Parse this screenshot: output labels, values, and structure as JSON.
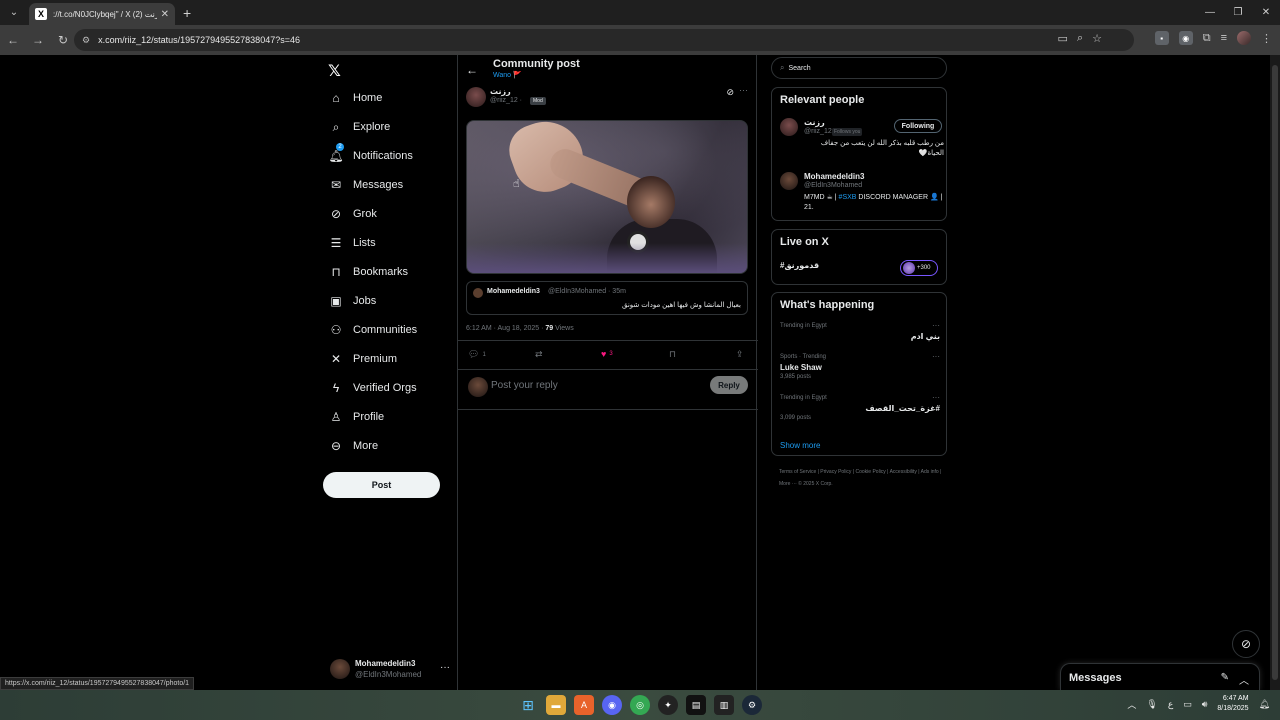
{
  "browser": {
    "tab_title": "://t.co/N0JClybqej\" / X رزنت (2)",
    "url": "x.com/riiz_12/status/1957279495527838047?s=46",
    "status_url": "https://x.com/riiz_12/status/1957279495527838047/photo/1"
  },
  "nav": {
    "items": [
      {
        "label": "Home",
        "icon": "home-icon"
      },
      {
        "label": "Explore",
        "icon": "search-icon"
      },
      {
        "label": "Notifications",
        "icon": "bell-icon",
        "badge": "2"
      },
      {
        "label": "Messages",
        "icon": "mail-icon"
      },
      {
        "label": "Grok",
        "icon": "grok-icon"
      },
      {
        "label": "Lists",
        "icon": "list-icon"
      },
      {
        "label": "Bookmarks",
        "icon": "bookmark-icon"
      },
      {
        "label": "Jobs",
        "icon": "briefcase-icon"
      },
      {
        "label": "Communities",
        "icon": "people-icon"
      },
      {
        "label": "Premium",
        "icon": "x-icon"
      },
      {
        "label": "Verified Orgs",
        "icon": "bolt-icon"
      },
      {
        "label": "Profile",
        "icon": "person-icon"
      },
      {
        "label": "More",
        "icon": "more-circle-icon"
      }
    ],
    "post_label": "Post",
    "account": {
      "name": "Mohamedeldin3",
      "handle": "@EldIn3Mohamed"
    }
  },
  "post": {
    "header_title": "Community post",
    "community": "Wano 🚩",
    "author_name": "رزنت",
    "author_handle": "@riiz_12 ·",
    "author_badge": "Mod",
    "quote": {
      "name": "Mohamedeldin3",
      "handle": "@EldIn3Mohamed · 35m",
      "text": "بعيال المانشا وش فيها اهين مودات شونق"
    },
    "time": "6:12 AM · Aug 18, 2025 ·",
    "views_count": "79",
    "views_label": "Views",
    "replies": "1",
    "likes": "3",
    "reply_placeholder": "Post your reply",
    "reply_button": "Reply"
  },
  "sidebar": {
    "search_placeholder": "Search",
    "relevant_title": "Relevant people",
    "people": [
      {
        "name": "رزنت",
        "handle": "@riiz_12",
        "follows_you": "Follows you",
        "button": "Following",
        "bio": "من رطب قلبه بذكر الله لن يتعب من جفاف الحياة🤍"
      },
      {
        "name": "Mohamedeldin3",
        "handle": "@EldIn3Mohamed",
        "bio_pre": "M7MD ☕ | ",
        "bio_link": "#SXB",
        "bio_post": " DISCORD MANAGER 👤 | 21."
      }
    ],
    "live_title": "Live on X",
    "live_tag": "#قدمورنق",
    "live_count": "+300",
    "happening_title": "What's happening",
    "trends": [
      {
        "context": "Trending in Egypt",
        "name": "بني ادم",
        "count": ""
      },
      {
        "context": "Sports · Trending",
        "name": "Luke Shaw",
        "count": "3,985 posts"
      },
      {
        "context": "Trending in Egypt",
        "name": "#غزة_تحت_القصف",
        "count": "3,099 posts"
      }
    ],
    "show_more": "Show more",
    "footer": "Terms of Service  |  Privacy Policy  |  Cookie Policy  |  Accessibility  |  Ads info  |  More ···  © 2025 X Corp."
  },
  "messages_drawer": {
    "title": "Messages"
  },
  "taskbar": {
    "time": "6:47 AM",
    "date": "8/18/2025"
  }
}
